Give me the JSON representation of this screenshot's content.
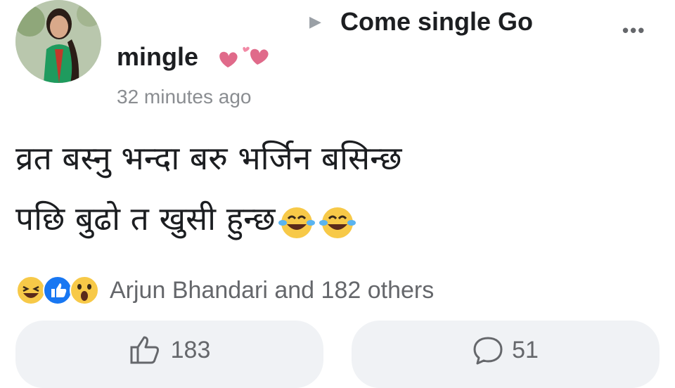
{
  "post": {
    "group_name_line1": "Come single Go",
    "group_name_line2": "mingle",
    "timestamp": "32 minutes ago",
    "text_line1": "व्रत बस्नु भन्दा बरु भर्जिन बसिन्छ",
    "text_line2": "पछि बुढो त खुसी हुन्छ"
  },
  "reactions": {
    "summary": "Arjun Bhandari and 182 others",
    "icons": [
      "laughing-react-icon",
      "like-react-icon",
      "wow-react-icon"
    ]
  },
  "actions": {
    "like_count": "183",
    "comment_count": "51"
  },
  "colors": {
    "pill_bg": "#f0f2f5",
    "muted_text": "#65676b",
    "like_blue": "#1877f2",
    "heart_pink": "#e06a8a"
  }
}
